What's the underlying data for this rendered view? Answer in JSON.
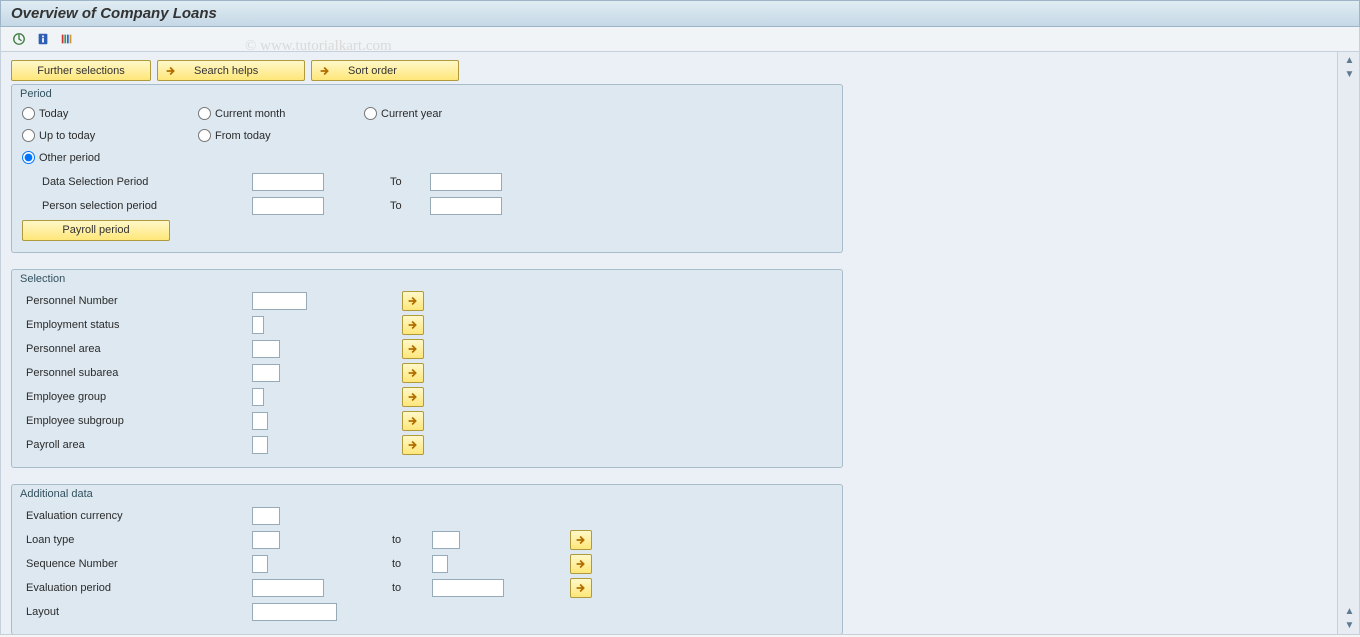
{
  "title": "Overview of Company Loans",
  "watermark": "© www.tutorialkart.com",
  "actionButtons": {
    "further": "Further selections",
    "searchHelps": "Search helps",
    "sortOrder": "Sort order"
  },
  "period": {
    "legend": "Period",
    "radios": {
      "today": "Today",
      "currentMonth": "Current month",
      "currentYear": "Current year",
      "upToToday": "Up to today",
      "fromToday": "From today",
      "otherPeriod": "Other period"
    },
    "selected": "otherPeriod",
    "dataSelectionLabel": "Data Selection Period",
    "dataSelectionFrom": "",
    "dataSelectionToLabel": "To",
    "dataSelectionTo": "",
    "personSelectionLabel": "Person selection period",
    "personSelectionFrom": "",
    "personSelectionToLabel": "To",
    "personSelectionTo": "",
    "payrollButton": "Payroll period"
  },
  "selection": {
    "legend": "Selection",
    "fields": [
      {
        "label": "Personnel Number",
        "value": "",
        "width": "w55"
      },
      {
        "label": "Employment status",
        "value": "",
        "width": "w12"
      },
      {
        "label": "Personnel area",
        "value": "",
        "width": "w30"
      },
      {
        "label": "Personnel subarea",
        "value": "",
        "width": "w30"
      },
      {
        "label": "Employee group",
        "value": "",
        "width": "w12"
      },
      {
        "label": "Employee subgroup",
        "value": "",
        "width": "w17"
      },
      {
        "label": "Payroll area",
        "value": "",
        "width": "w17"
      }
    ]
  },
  "additional": {
    "legend": "Additional data",
    "evalCurrency": {
      "label": "Evaluation currency",
      "value": ""
    },
    "loanType": {
      "label": "Loan type",
      "from": "",
      "toLabel": "to",
      "to": ""
    },
    "seqNumber": {
      "label": "Sequence Number",
      "from": "",
      "toLabel": "to",
      "to": ""
    },
    "evalPeriod": {
      "label": "Evaluation period",
      "from": "",
      "toLabel": "to",
      "to": ""
    },
    "layout": {
      "label": "Layout",
      "value": ""
    }
  }
}
